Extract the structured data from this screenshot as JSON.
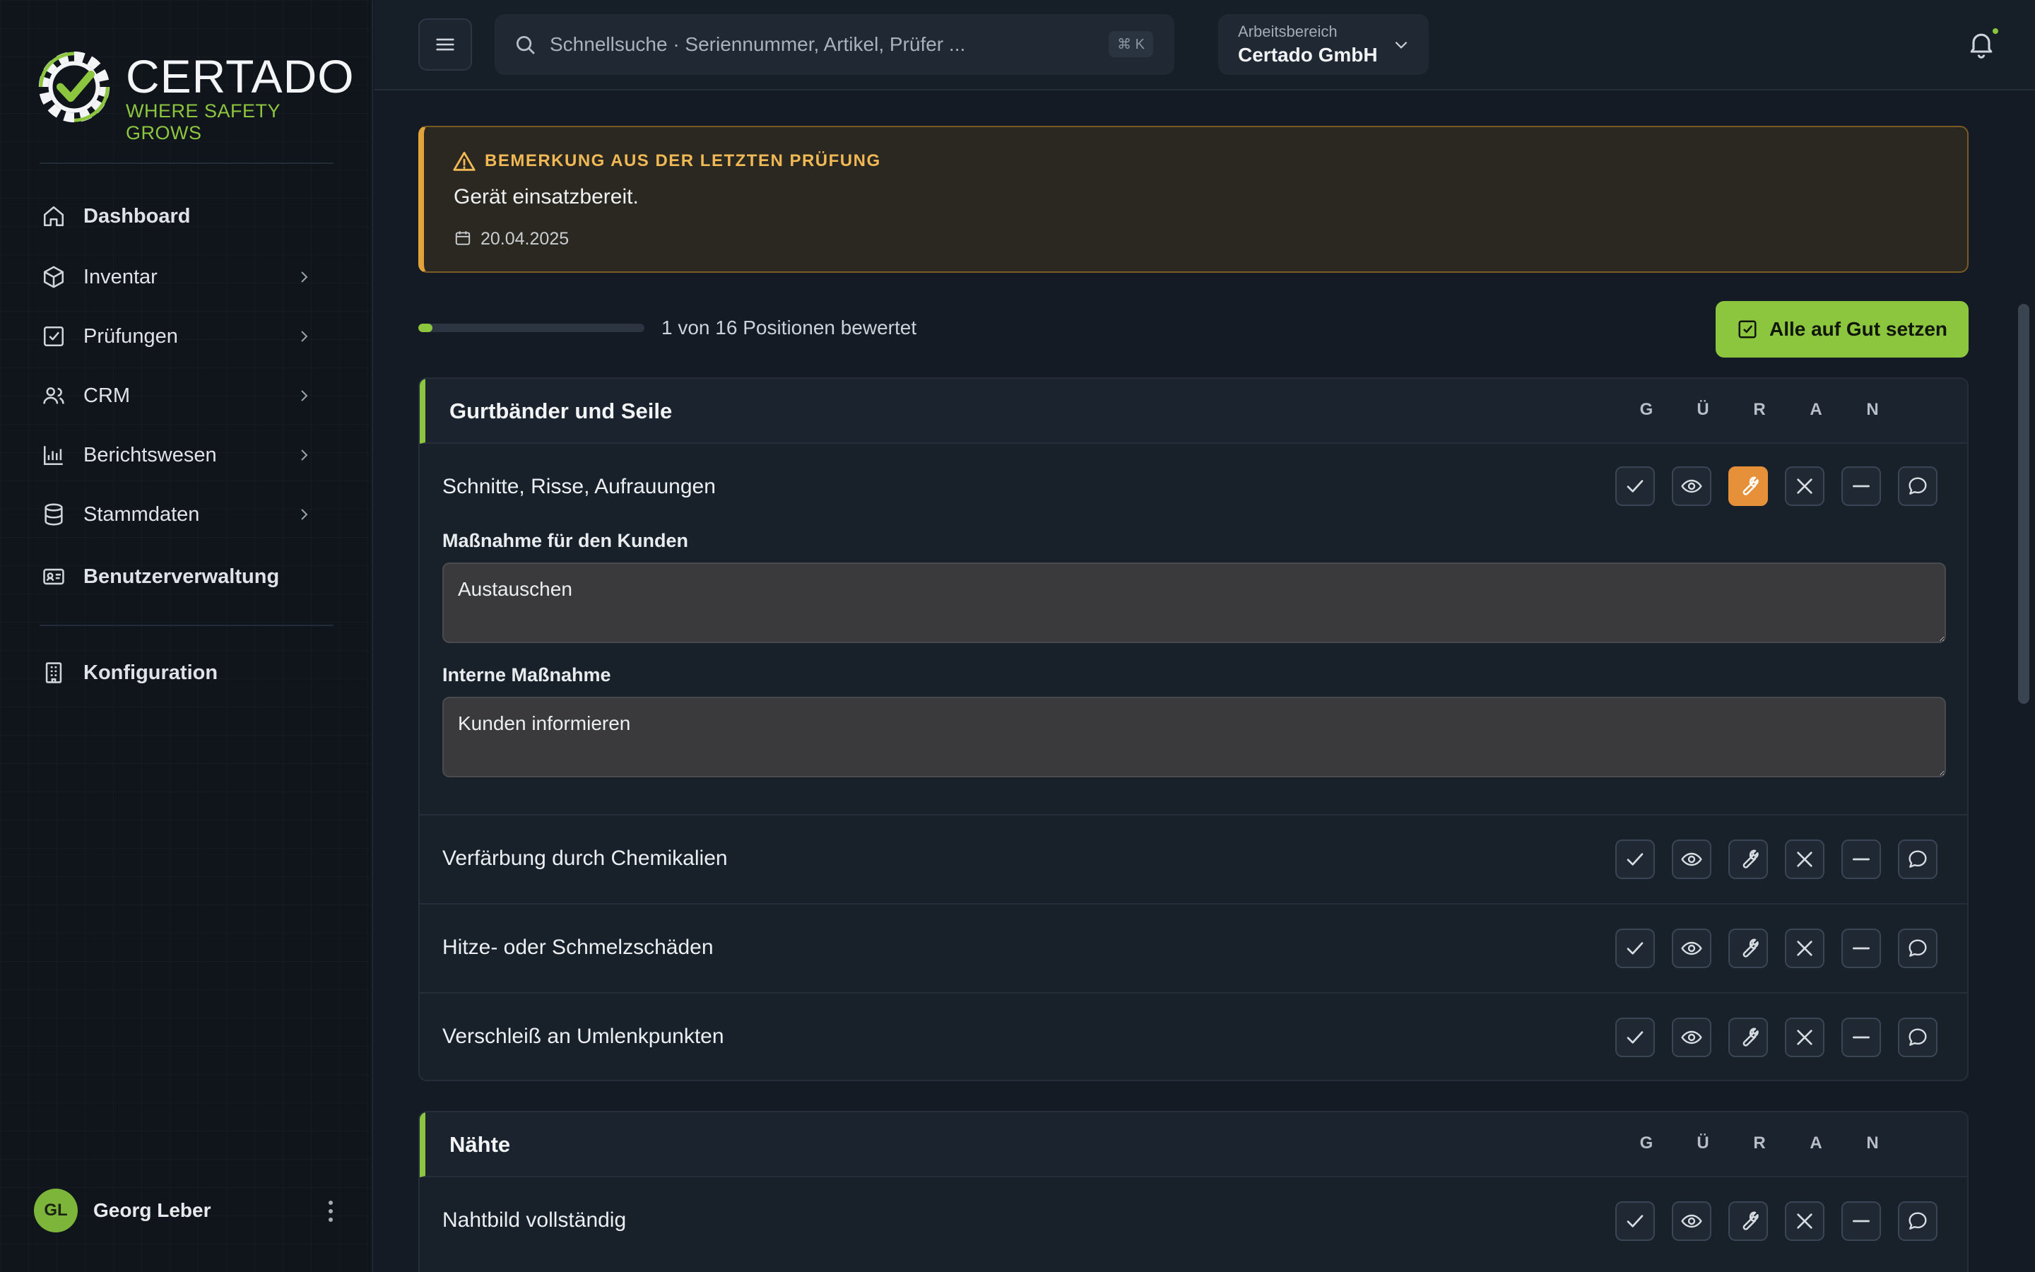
{
  "brand": {
    "name": "CERTADO",
    "tagline": "WHERE SAFETY GROWS"
  },
  "sidebar": {
    "items": [
      {
        "label": "Dashboard",
        "icon": "home-icon",
        "bold": true,
        "chevron": false
      },
      {
        "label": "Inventar",
        "icon": "box-icon",
        "bold": false,
        "chevron": true
      },
      {
        "label": "Prüfungen",
        "icon": "checkbox-icon",
        "bold": false,
        "chevron": true
      },
      {
        "label": "CRM",
        "icon": "users-icon",
        "bold": false,
        "chevron": true
      },
      {
        "label": "Berichtswesen",
        "icon": "bar-chart-icon",
        "bold": false,
        "chevron": true
      },
      {
        "label": "Stammdaten",
        "icon": "database-icon",
        "bold": false,
        "chevron": true
      },
      {
        "label": "Benutzerverwaltung",
        "icon": "id-card-icon",
        "bold": true,
        "chevron": false
      },
      {
        "label": "Konfiguration",
        "icon": "building-icon",
        "bold": true,
        "chevron": false
      }
    ],
    "user": {
      "initials": "GL",
      "name": "Georg Leber"
    }
  },
  "topbar": {
    "search_placeholder": "Schnellsuche · Seriennummer, Artikel, Prüfer ...",
    "shortcut": "⌘ K",
    "workspace_label": "Arbeitsbereich",
    "workspace_value": "Certado GmbH"
  },
  "alert": {
    "title": "BEMERKUNG AUS DER LETZTEN PRÜFUNG",
    "text": "Gerät einsatzbereit.",
    "date": "20.04.2025"
  },
  "progress": {
    "rated": 1,
    "total": 16,
    "text": "1 von 16 Positionen bewertet"
  },
  "actions": {
    "all_good_label": "Alle auf Gut setzen"
  },
  "columns": [
    "G",
    "Ü",
    "R",
    "A",
    "N"
  ],
  "sections": [
    {
      "title": "Gurtbänder und Seile",
      "rows": [
        {
          "label": "Schnitte, Risse, Aufrauungen",
          "selected": "R",
          "customer_action_label": "Maßnahme für den Kunden",
          "customer_action_value": "Austauschen",
          "internal_action_label": "Interne Maßnahme",
          "internal_action_value": "Kunden informieren"
        },
        {
          "label": "Verfärbung durch Chemikalien"
        },
        {
          "label": "Hitze- oder Schmelzschäden"
        },
        {
          "label": "Verschleiß an Umlenkpunkten"
        }
      ]
    },
    {
      "title": "Nähte",
      "rows": [
        {
          "label": "Nahtbild vollständig"
        }
      ]
    }
  ],
  "colors": {
    "accent": "#8cc63f",
    "warning": "#e0a43a",
    "repair_active": "#e6913a"
  }
}
